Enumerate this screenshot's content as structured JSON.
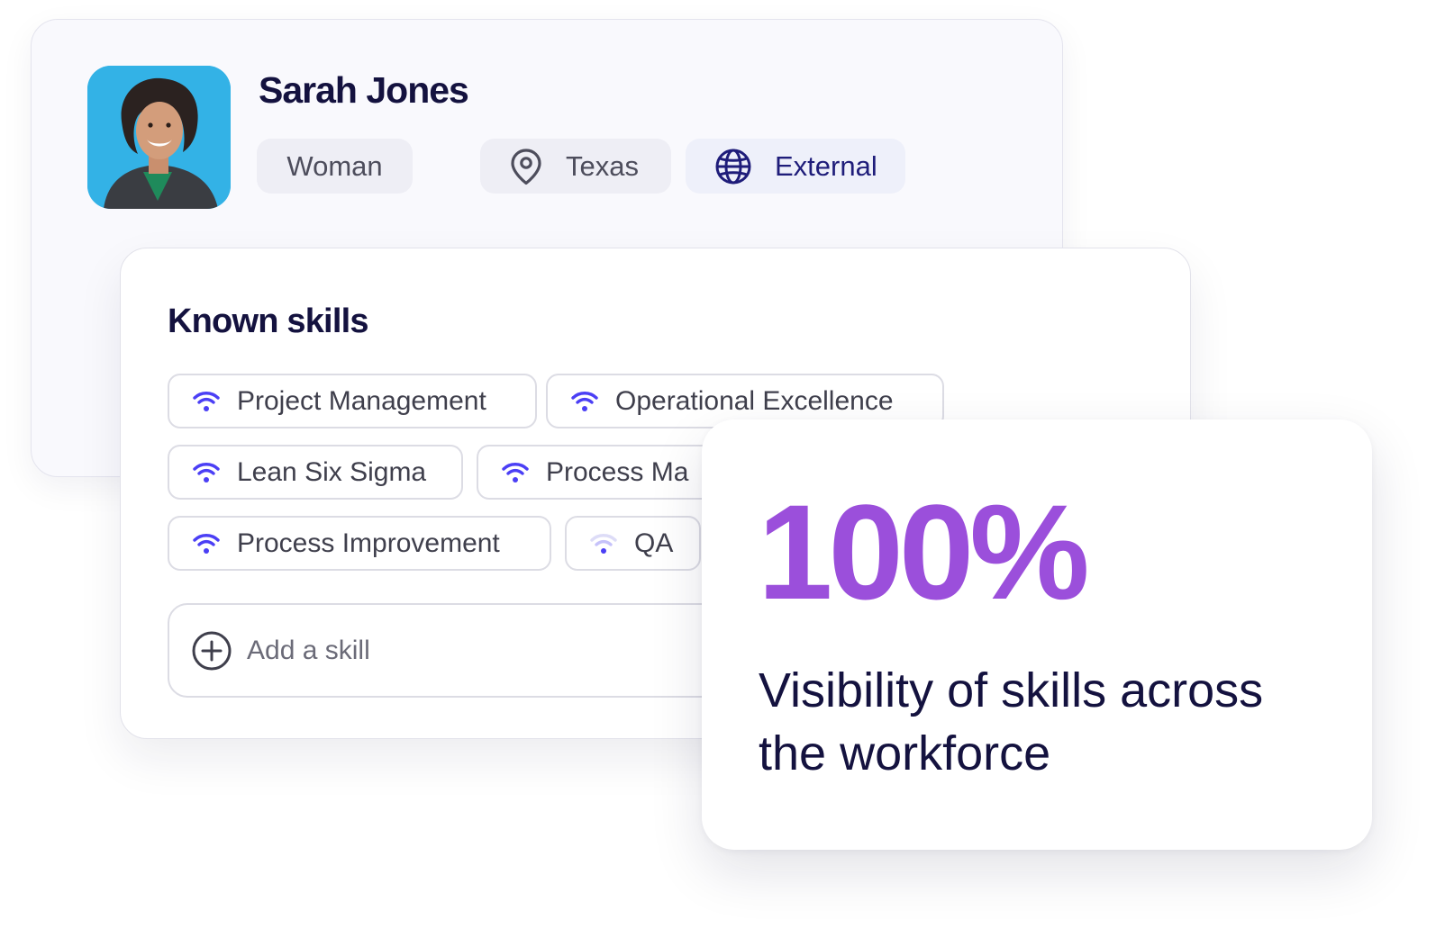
{
  "profile": {
    "name": "Sarah Jones",
    "avatar_icon": "person-photo",
    "tags": {
      "gender": "Woman",
      "location": "Texas",
      "location_icon": "map-pin-icon",
      "type": "External",
      "type_icon": "globe-icon"
    }
  },
  "skills": {
    "title": "Known skills",
    "items": [
      {
        "label": "Project Management",
        "level": "high"
      },
      {
        "label": "Operational Excellence",
        "level": "high"
      },
      {
        "label": "Lean Six Sigma",
        "level": "high"
      },
      {
        "label": "Process Ma",
        "level": "high"
      },
      {
        "label": "Process Improvement",
        "level": "high"
      },
      {
        "label": "QA",
        "level": "low"
      }
    ],
    "add_placeholder": "Add a skill"
  },
  "stat": {
    "value": "100%",
    "caption": "Visibility of skills across the workforce"
  },
  "colors": {
    "heading": "#14123f",
    "accent_purple": "#9b4fdb",
    "signal_blue": "#4b3ff5",
    "chip_bg": "#eeeef5"
  }
}
